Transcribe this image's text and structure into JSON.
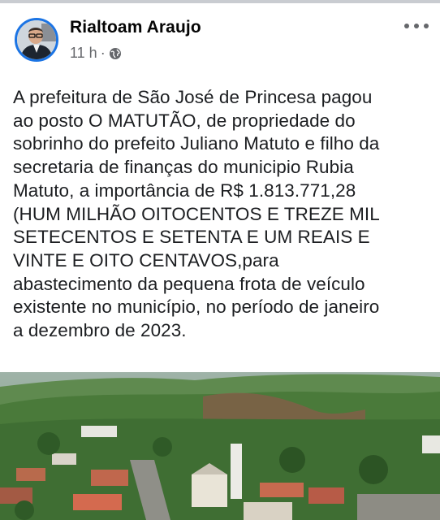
{
  "post": {
    "author": "Rialtoam Araujo",
    "time": "11 h",
    "separator": "·",
    "privacy_icon": "globe-icon",
    "menu_icon": "more-options-icon",
    "text": "A prefeitura de São José de Princesa pagou\nao posto O MATUTÃO, de propriedade do\nsobrinho do prefeito Juliano Matuto e filho da\nsecretaria de finanças do municipio Rubia\nMatuto, a importância de  R$ 1.813.771,28\n(HUM MILHÃO OITOCENTOS E TREZE MIL\nSETECENTOS E SETENTA E UM REAIS E\nVINTE E OITO CENTAVOS,para\nabastecimento da pequena frota de veículo\nexistente no município, no período de janeiro\na dezembro de 2023."
  },
  "colors": {
    "avatar_ring": "#1b74e4",
    "meta_text": "#65676b"
  }
}
